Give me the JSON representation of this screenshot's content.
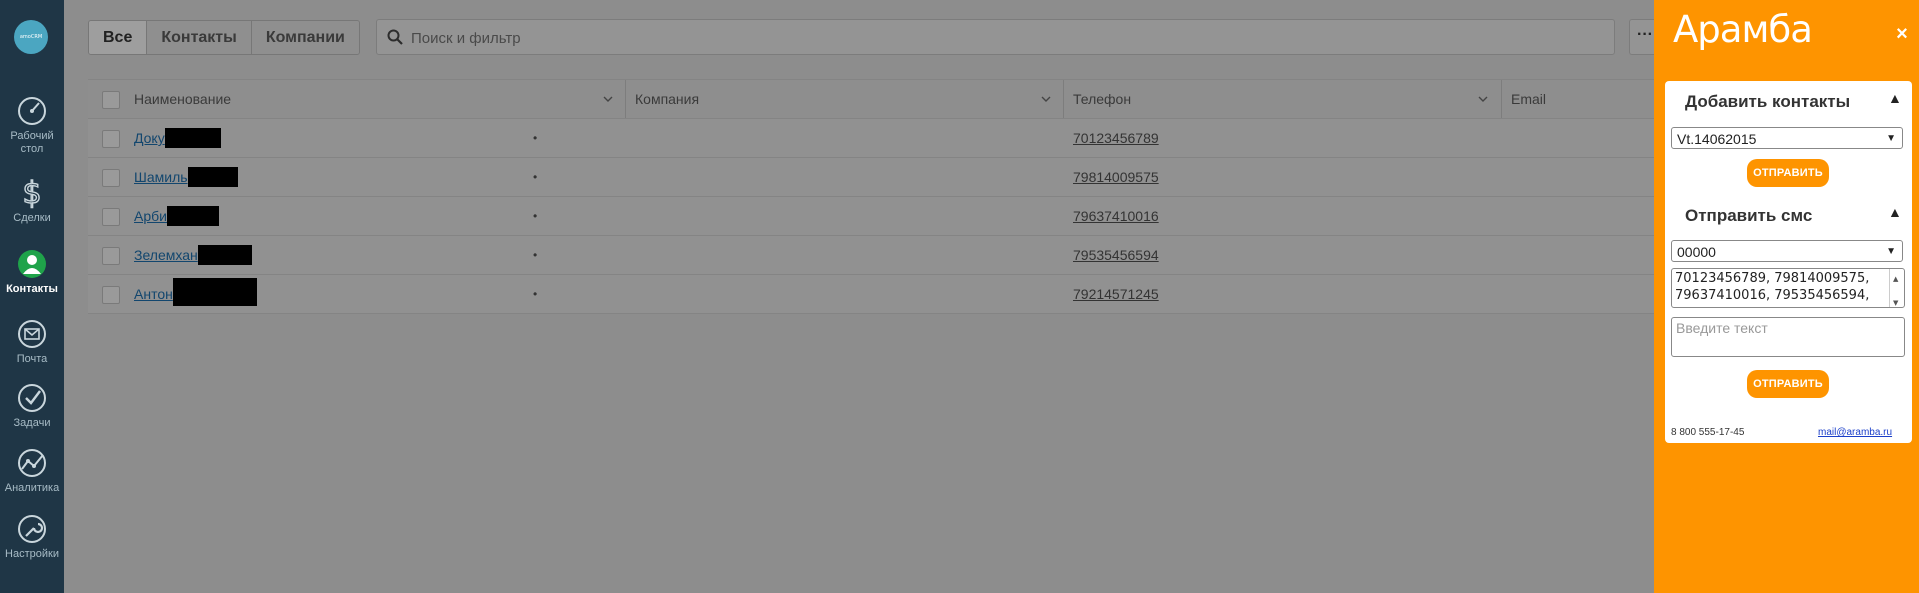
{
  "sidebar": {
    "logo_text": "amoCRM",
    "items": [
      {
        "label": "Рабочий стол",
        "line1": "Рабочий",
        "line2": "стол"
      },
      {
        "label": "Сделки"
      },
      {
        "label": "Контакты",
        "active": true
      },
      {
        "label": "Почта"
      },
      {
        "label": "Задачи"
      },
      {
        "label": "Аналитика"
      },
      {
        "label": "Настройки"
      }
    ]
  },
  "tabs": [
    "Все",
    "Контакты",
    "Компании"
  ],
  "search": {
    "placeholder": "Поиск и фильтр"
  },
  "more_label": "···",
  "table": {
    "columns": [
      "Наименование",
      "Компания",
      "Телефон",
      "Email"
    ],
    "rows": [
      {
        "name": "Доку",
        "company": "•",
        "phone": "70123456789"
      },
      {
        "name": "Шамиль",
        "company": "•",
        "phone": "79814009575"
      },
      {
        "name": "Арби",
        "company": "•",
        "phone": "79637410016"
      },
      {
        "name": "Зелемхан",
        "company": "•",
        "phone": "79535456594"
      },
      {
        "name": "Антон",
        "company": "•",
        "phone": "79214571245"
      }
    ]
  },
  "panel": {
    "brand": "Арамба",
    "close": "×",
    "add_contacts": {
      "title": "Добавить контакты",
      "toggle": "▲",
      "selected": "Vt.14062015",
      "button": "ОТПРАВИТЬ"
    },
    "send_sms": {
      "title": "Отправить смс",
      "toggle": "▲",
      "sender": "00000",
      "numbers": "70123456789, 79814009575, 79637410016, 79535456594,",
      "message_placeholder": "Введите текст",
      "button": "ОТПРАВИТЬ"
    },
    "footer": {
      "phone": "8 800 555-17-45",
      "email": "mail@aramba.ru"
    }
  },
  "colors": {
    "panel": "#fe9400",
    "sidebar": "#1f3646",
    "overlay": "#8d8d8d"
  }
}
